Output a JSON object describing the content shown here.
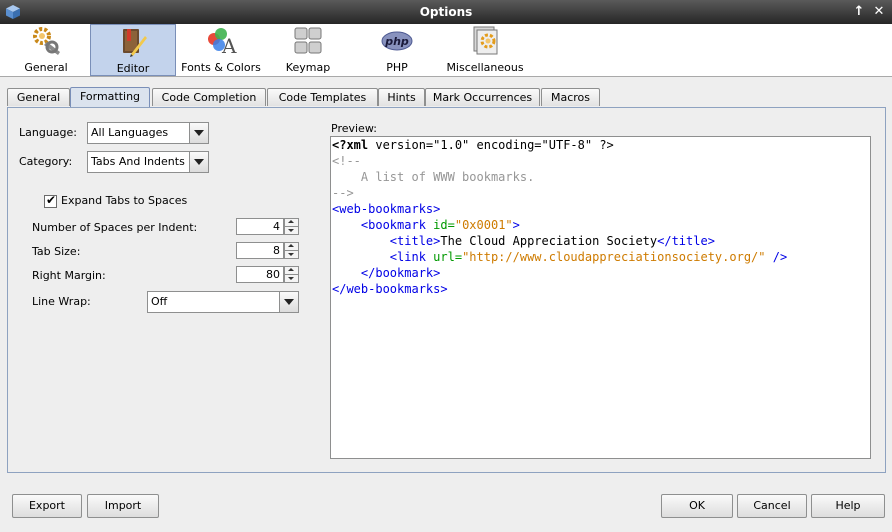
{
  "window": {
    "title": "Options"
  },
  "categories": [
    {
      "label": "General",
      "icon": "gears-icon",
      "selected": false
    },
    {
      "label": "Editor",
      "icon": "book-pen-icon",
      "selected": true
    },
    {
      "label": "Fonts & Colors",
      "icon": "fonts-colors-icon",
      "selected": false
    },
    {
      "label": "Keymap",
      "icon": "keyboard-icon",
      "selected": false
    },
    {
      "label": "PHP",
      "icon": "php-icon",
      "selected": false
    },
    {
      "label": "Miscellaneous",
      "icon": "misc-icon",
      "selected": false
    }
  ],
  "tabs": [
    {
      "label": "General"
    },
    {
      "label": "Formatting"
    },
    {
      "label": "Code Completion"
    },
    {
      "label": "Code Templates"
    },
    {
      "label": "Hints"
    },
    {
      "label": "Mark Occurrences"
    },
    {
      "label": "Macros"
    }
  ],
  "selected_tab": "Formatting",
  "form": {
    "language_label": "Language:",
    "language_value": "All Languages",
    "category_label": "Category:",
    "category_value": "Tabs And Indents",
    "expand_tabs_label": "Expand Tabs to Spaces",
    "expand_tabs_checked": true,
    "spaces_label": "Number of Spaces per Indent:",
    "spaces_value": "4",
    "tabsize_label": "Tab Size:",
    "tabsize_value": "8",
    "margin_label": "Right Margin:",
    "margin_value": "80",
    "linewrap_label": "Line Wrap:",
    "linewrap_value": "Off"
  },
  "preview": {
    "label": "Preview:",
    "lines": [
      [
        {
          "t": "<?xml",
          "c": "black",
          "b": true
        },
        {
          "t": " version=\"1.0\" encoding=\"UTF-8\" ?>",
          "c": "black"
        }
      ],
      [
        {
          "t": "<!--",
          "c": "grey"
        }
      ],
      [
        {
          "t": "    A list of WWW bookmarks.",
          "c": "grey"
        }
      ],
      [
        {
          "t": "-->",
          "c": "grey"
        }
      ],
      [
        {
          "t": "<web-bookmarks>",
          "c": "blue"
        }
      ],
      [
        {
          "t": "    <bookmark ",
          "c": "blue"
        },
        {
          "t": "id=",
          "c": "green"
        },
        {
          "t": "\"0x0001\"",
          "c": "orange"
        },
        {
          "t": ">",
          "c": "blue"
        }
      ],
      [
        {
          "t": "        <title>",
          "c": "blue"
        },
        {
          "t": "The Cloud Appreciation Society",
          "c": "black"
        },
        {
          "t": "</title>",
          "c": "blue"
        }
      ],
      [
        {
          "t": "        <link ",
          "c": "blue"
        },
        {
          "t": "url=",
          "c": "green"
        },
        {
          "t": "\"http://www.cloudappreciationsociety.org/\"",
          "c": "orange"
        },
        {
          "t": " />",
          "c": "blue"
        }
      ],
      [
        {
          "t": "    </bookmark>",
          "c": "blue"
        }
      ],
      [
        {
          "t": "</web-bookmarks>",
          "c": "blue"
        }
      ]
    ]
  },
  "buttons": {
    "export": "Export",
    "import": "Import",
    "ok": "OK",
    "cancel": "Cancel",
    "help": "Help"
  },
  "colors": {
    "xml_tag": "#0000e6",
    "xml_attr": "#009900",
    "xml_value": "#ce7b00",
    "xml_comment": "#969696",
    "selection": "#c3d3ec"
  }
}
